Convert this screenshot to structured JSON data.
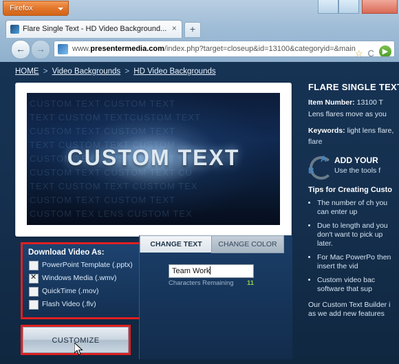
{
  "browser": {
    "app_button": "Firefox",
    "tab_title": "Flare Single Text - HD Video Background...",
    "new_tab_label": "+",
    "tab_close": "×",
    "url_prefix": "www.",
    "url_host": "presentermedia.com",
    "url_path": "/index.php?target=closeup&id=13100&categoryid=&main",
    "back_label": "←",
    "forward_label": "→",
    "star_icon": "☆",
    "shield_icon": "C",
    "go_icon": "▶",
    "window_minimize": "–",
    "window_maximize": "□",
    "window_close": "✕"
  },
  "breadcrumb": {
    "items": [
      "HOME",
      "Video Backgrounds",
      "HD Video Backgrounds"
    ],
    "separator": ">"
  },
  "preview": {
    "video_text": "CUSTOM  TEXT",
    "matrix_rows": [
      "CUSTOM  TEXT  CUSTOM  TEXT",
      "TEXT CUSTOM TEXTCUSTOM TEXT",
      "CUSTOM  TEXT  CUSTOM  TEXT",
      "TEXT  CUSTOM  TEXT  CUSTOM",
      "CUSTOM  TEXT  CUSTOM  TEXT",
      "CUSTOM TEXT CUSTOM TEXT CU",
      "TEXT CUSTOM TEXT CUSTOM TEX",
      "CUSTOM  TEXT  CUSTOM  TEXT",
      "CUSTOM TEX  LENS CUSTOM TEX"
    ]
  },
  "download": {
    "title": "Download Video As:",
    "options": [
      {
        "label": "PowerPoint Template (.pptx)",
        "checked": false
      },
      {
        "label": "Windows Media (.wmv)",
        "checked": true
      },
      {
        "label": "QuickTime (.mov)",
        "checked": false
      },
      {
        "label": "Flash Video (.flv)",
        "checked": false
      }
    ]
  },
  "customize": {
    "button_label": "CUSTOMIZE"
  },
  "text_panel": {
    "tab_active": "CHANGE TEXT",
    "tab_inactive": "CHANGE COLOR",
    "input_value": "Team Work",
    "remaining_label": "Characters Remaining",
    "remaining_count": "11"
  },
  "details": {
    "title": "FLARE SINGLE TEXT",
    "item_label": "Item Number:",
    "item_number": "13100",
    "item_trailing": "T",
    "description": "Lens flares move as you",
    "keywords_label": "Keywords:",
    "keywords_inline": "light lens flare,",
    "keywords_more": "flare",
    "promo_title": "ADD YOUR",
    "promo_sub": "Use the tools f",
    "promo_icon_a": "A",
    "promo_icon_b": "B",
    "tips_title": "Tips for Creating Custo",
    "tips": [
      "The number of ch you can enter up",
      "Due to length and you don't want to pick up later.",
      "For Mac PowerPo then insert the vid",
      "Custom video bac software that sup"
    ],
    "footer": "Our Custom Text Builder i as we add new features"
  }
}
